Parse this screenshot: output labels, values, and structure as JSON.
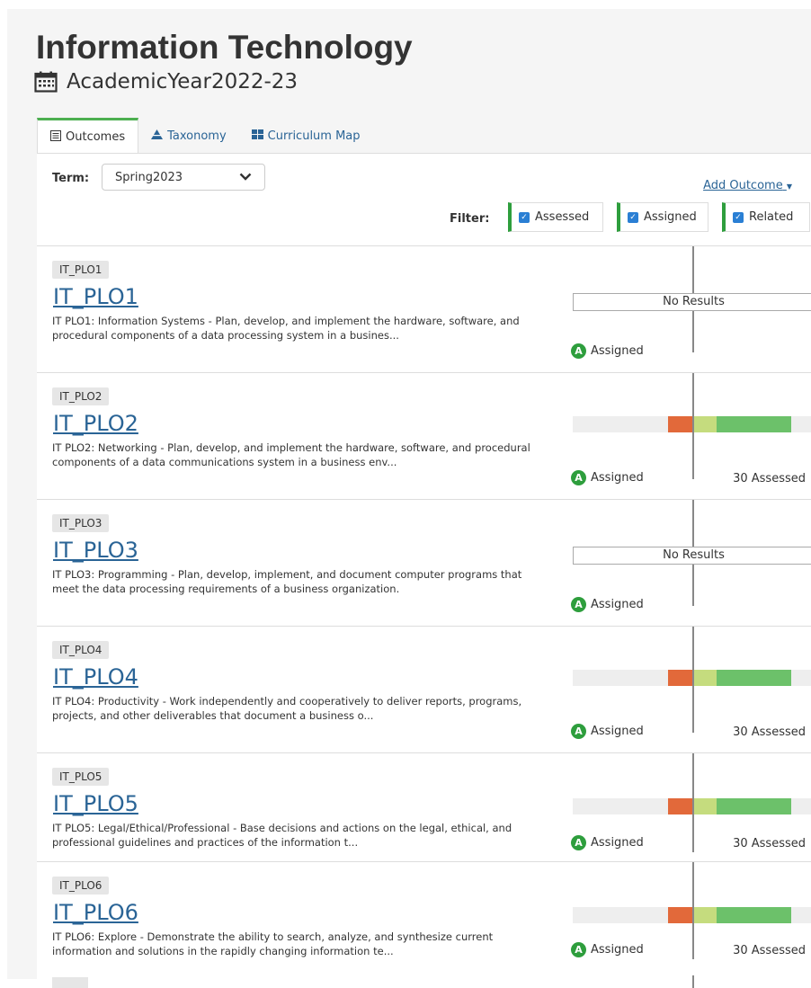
{
  "header": {
    "title": "Information Technology",
    "academic_year": "AcademicYear2022-23",
    "calendar_icon": "calendar-icon"
  },
  "tabs": [
    {
      "label": "Outcomes",
      "icon": "list-icon",
      "active": true
    },
    {
      "label": "Taxonomy",
      "icon": "pyramid-icon",
      "active": false
    },
    {
      "label": "Curriculum Map",
      "icon": "grid-icon",
      "active": false
    }
  ],
  "controls": {
    "term_label": "Term:",
    "term_value": "Spring2023",
    "add_outcome": "Add Outcome",
    "filter_label": "Filter:",
    "filters": [
      {
        "label": "Assessed",
        "checked": true
      },
      {
        "label": "Assigned",
        "checked": true
      },
      {
        "label": "Related",
        "checked": true
      }
    ]
  },
  "outcomes": [
    {
      "badge": "IT_PLO1",
      "title": "IT_PLO1",
      "description": "IT PLO1: Information Systems - Plan, develop, and implement the hardware, software, and procedural components of a data processing system in a busines...",
      "result": "No Results",
      "assigned": "Assigned",
      "assessed": ""
    },
    {
      "badge": "IT_PLO2",
      "title": "IT_PLO2",
      "description": "IT PLO2: Networking - Plan, develop, and implement the hardware, software, and procedural components of a data communications system in a business env...",
      "result": "",
      "assigned": "Assigned",
      "assessed": "30 Assessed"
    },
    {
      "badge": "IT_PLO3",
      "title": "IT_PLO3",
      "description": "IT PLO3: Programming - Plan, develop, implement, and document computer programs that meet the data processing requirements of a business organization.",
      "result": "No Results",
      "assigned": "Assigned",
      "assessed": ""
    },
    {
      "badge": "IT_PLO4",
      "title": "IT_PLO4",
      "description": "IT PLO4: Productivity - Work independently and cooperatively to deliver reports, programs, projects, and other deliverables that document a business o...",
      "result": "",
      "assigned": "Assigned",
      "assessed": "30 Assessed"
    },
    {
      "badge": "IT_PLO5",
      "title": "IT_PLO5",
      "description": "IT PLO5: Legal/Ethical/Professional - Base decisions and actions on the legal, ethical, and professional guidelines and practices of the information t...",
      "result": "",
      "assigned": "Assigned",
      "assessed": "30 Assessed"
    },
    {
      "badge": "IT_PLO6",
      "title": "IT_PLO6",
      "description": "IT PLO6: Explore - Demonstrate the ability to search, analyze, and synthesize current information and solutions in the rapidly changing information te...",
      "result": "",
      "assigned": "Assigned",
      "assessed": "30 Assessed"
    }
  ],
  "colors": {
    "accent_green": "#2e9e3d",
    "link_blue": "#2a6496",
    "bar_red": "#e2693a",
    "bar_lime": "#c5dc7e",
    "bar_green": "#6cc16a"
  }
}
